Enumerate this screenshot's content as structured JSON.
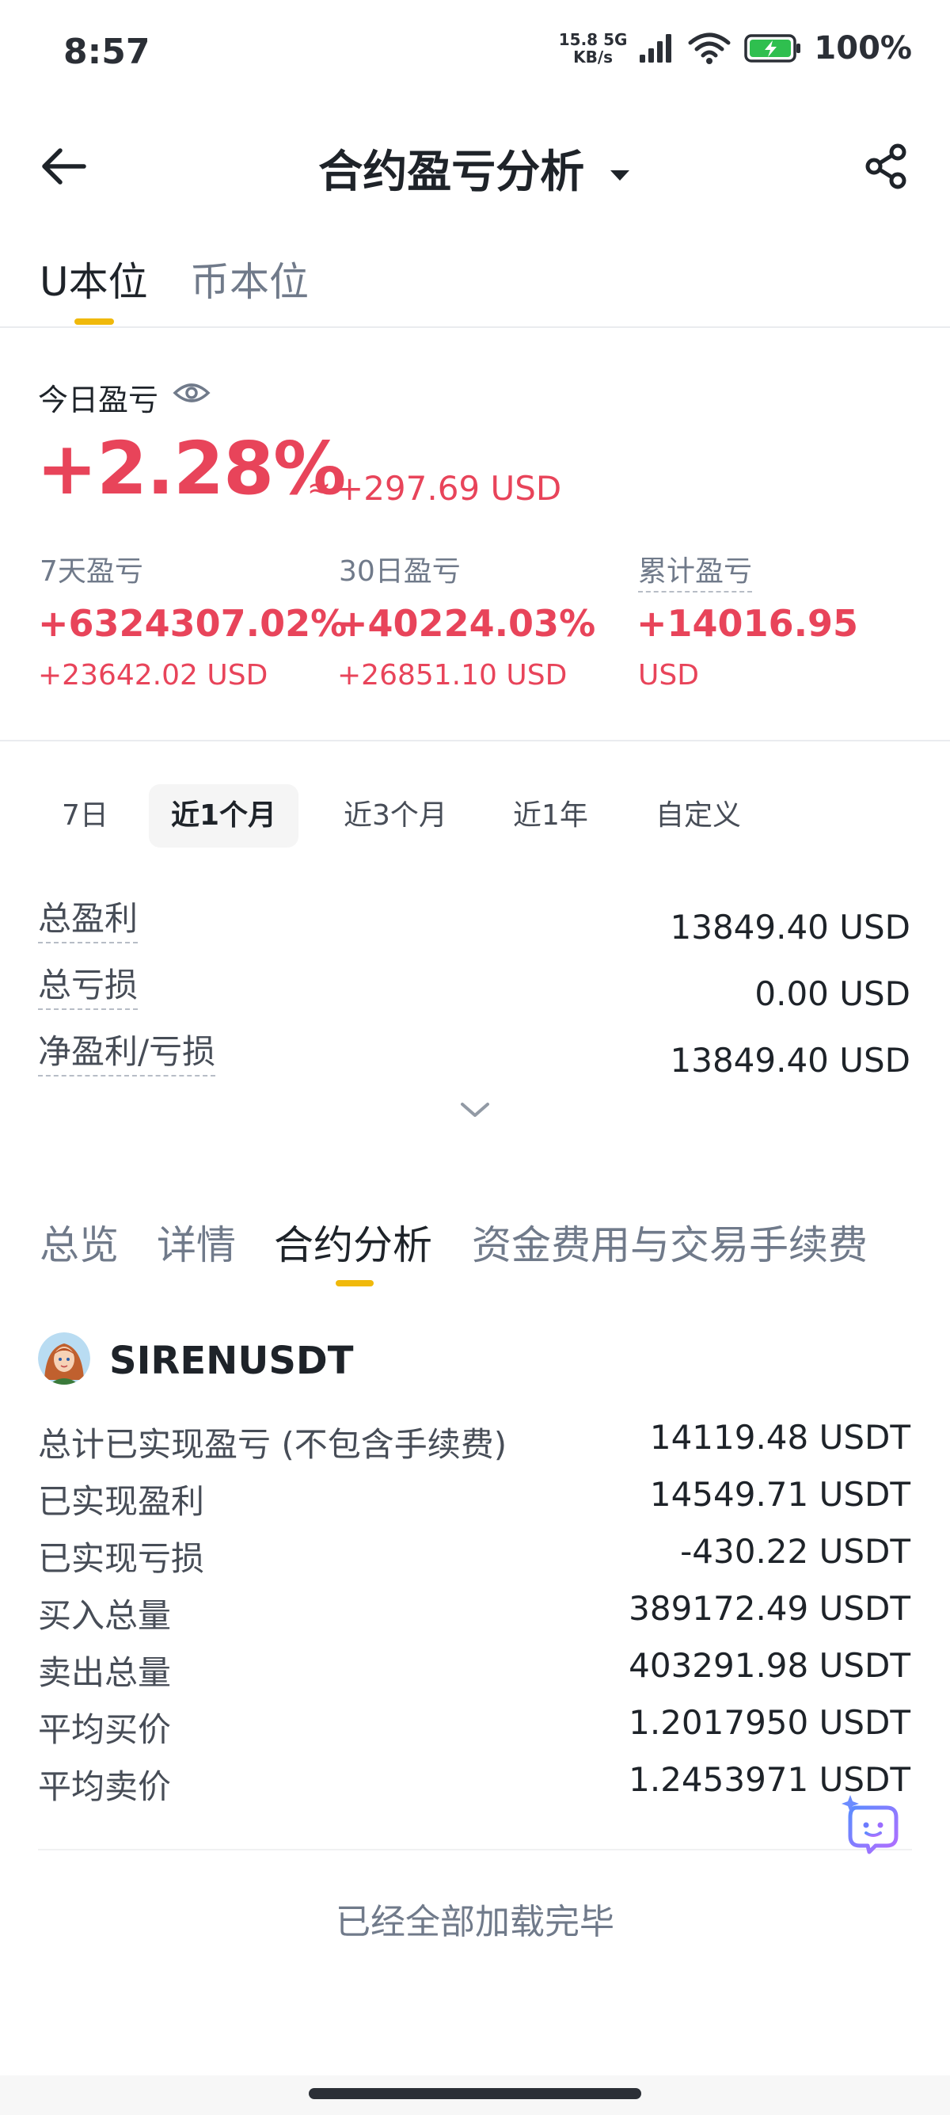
{
  "status_bar": {
    "time": "8:57",
    "net_speed_value": "15.8",
    "net_speed_unit": "KB/s",
    "net_type": "5G",
    "battery_pct": "100%"
  },
  "header": {
    "title": "合约盈亏分析",
    "dropdown_icon": "caret-down-icon",
    "back_icon": "arrow-left-icon",
    "share_icon": "share-icon"
  },
  "unit_tabs": [
    {
      "label": "U本位",
      "active": true
    },
    {
      "label": "币本位",
      "active": false
    }
  ],
  "today": {
    "label": "今日盈亏",
    "pct": "+2.28%",
    "approx": "≈",
    "usd": "+297.69 USD"
  },
  "periods": [
    {
      "label": "7天盈亏",
      "pct": "+6324307.02%",
      "usd": "+23642.02 USD"
    },
    {
      "label": "30日盈亏",
      "pct": "+40224.03%",
      "usd": "+26851.10 USD"
    },
    {
      "label": "累计盈亏",
      "pct": "+14016.95",
      "usd": "USD"
    }
  ],
  "ranges": [
    {
      "label": "7日",
      "active": false
    },
    {
      "label": "近1个月",
      "active": true
    },
    {
      "label": "近3个月",
      "active": false
    },
    {
      "label": "近1年",
      "active": false
    },
    {
      "label": "自定义",
      "active": false
    }
  ],
  "summary": [
    {
      "label": "总盈利",
      "value": "13849.40 USD"
    },
    {
      "label": "总亏损",
      "value": "0.00 USD"
    },
    {
      "label": "净盈利/亏损",
      "value": "13849.40 USD"
    }
  ],
  "section_tabs": [
    {
      "label": "总览",
      "active": false
    },
    {
      "label": "详情",
      "active": false
    },
    {
      "label": "合约分析",
      "active": true
    },
    {
      "label": "资金费用与交易手续费",
      "active": false
    }
  ],
  "symbol": {
    "name": "SIRENUSDT",
    "stats": [
      {
        "label": "总计已实现盈亏 (不包含手续费)",
        "value": "14119.48 USDT"
      },
      {
        "label": "已实现盈利",
        "value": "14549.71 USDT"
      },
      {
        "label": "已实现亏损",
        "value": "-430.22 USDT"
      },
      {
        "label": "买入总量",
        "value": "389172.49 USDT"
      },
      {
        "label": "卖出总量",
        "value": "403291.98 USDT"
      },
      {
        "label": "平均买价",
        "value": "1.2017950 USDT"
      },
      {
        "label": "平均卖价",
        "value": "1.2453971 USDT"
      }
    ]
  },
  "footer": {
    "loaded_text": "已经全部加载完毕"
  },
  "colors": {
    "accent": "#f0b90b",
    "profit": "#e8445a",
    "text_primary": "#1e2329",
    "text_secondary": "#707a8a"
  }
}
